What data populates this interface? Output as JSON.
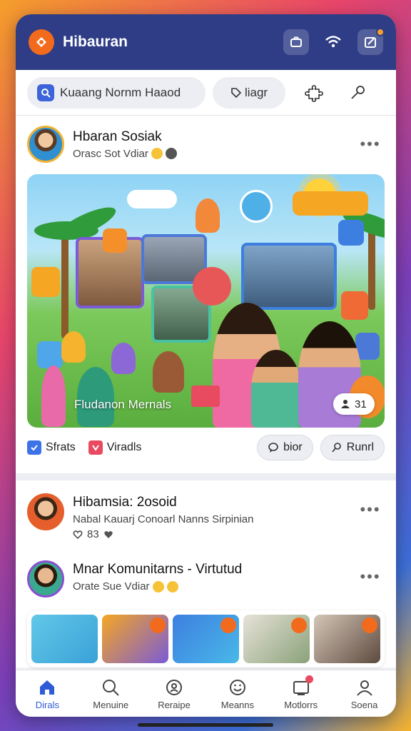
{
  "app": {
    "title": "Hibauran"
  },
  "search": {
    "main_label": "Kuaang Nornm Haaod",
    "secondary_label": "liagr"
  },
  "posts": [
    {
      "name": "Hbaran Sosiak",
      "subtitle": "Orasc Sot Vdiar",
      "image_caption": "Fludanon Mernals",
      "reaction_count": "31",
      "tags": [
        "Sfrats",
        "Viradls"
      ],
      "actions": [
        "bior",
        "Runrl"
      ]
    },
    {
      "name": "Hibamsia: 2osoid",
      "subtitle": "Nabal Kauarj Conoarl Nanns Sirpinian",
      "reaction_count": "83"
    },
    {
      "name": "Mnar Komunitarns - Virtutud",
      "subtitle": "Orate Sue Vdiar"
    }
  ],
  "nav": {
    "items": [
      "Dirals",
      "Menuine",
      "Reraipe",
      "Meanns",
      "Motlorrs",
      "Soena"
    ],
    "active_index": 0
  },
  "colors": {
    "appbar": "#2e3d86",
    "accent": "#f26b1d",
    "active_nav": "#2f5bd6"
  },
  "icons": [
    "logo-icon",
    "camera-icon",
    "wifi-icon",
    "share-icon",
    "search-icon",
    "puzzle-icon",
    "key-icon",
    "more-icon",
    "home-icon",
    "profile-icon"
  ]
}
